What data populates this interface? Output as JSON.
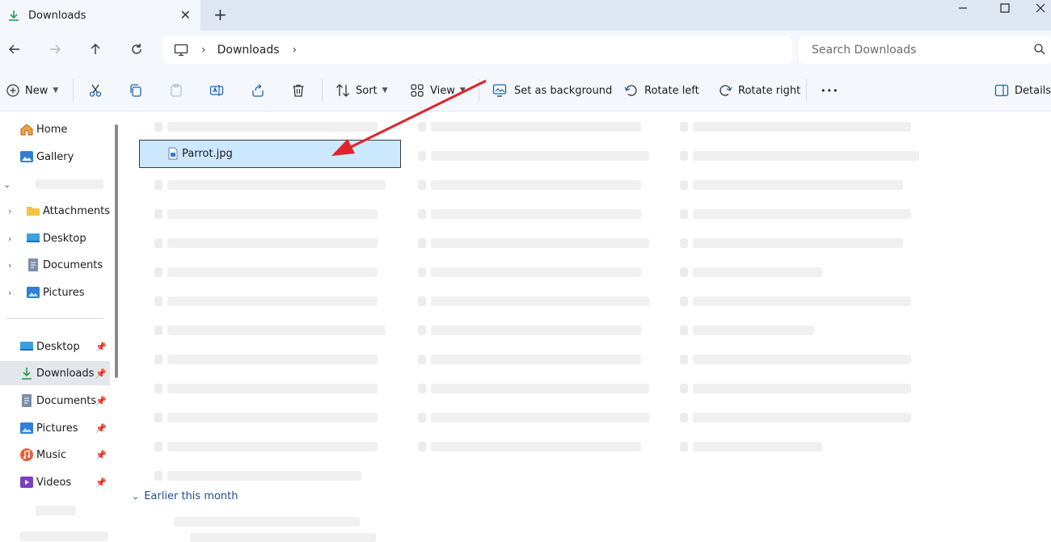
{
  "window": {
    "tab_title": "Downloads",
    "tab_close": "✕",
    "new_tab": "+"
  },
  "address": {
    "breadcrumb": [
      "Downloads"
    ],
    "search_placeholder": "Search Downloads"
  },
  "toolbar": {
    "new_label": "New",
    "sort_label": "Sort",
    "view_label": "View",
    "set_background_label": "Set as background",
    "rotate_left_label": "Rotate left",
    "rotate_right_label": "Rotate right",
    "more_label": "•••",
    "details_label": "Details"
  },
  "sidebar": {
    "top_items": [
      {
        "label": "Home",
        "icon": "home-icon"
      },
      {
        "label": "Gallery",
        "icon": "gallery-icon"
      }
    ],
    "tree_items": [
      {
        "label": "Attachments",
        "icon": "folder-icon"
      },
      {
        "label": "Desktop",
        "icon": "desktop-icon"
      },
      {
        "label": "Documents",
        "icon": "documents-icon"
      },
      {
        "label": "Pictures",
        "icon": "pictures-icon"
      }
    ],
    "quick_access": [
      {
        "label": "Desktop",
        "icon": "desktop-icon",
        "pinned": true
      },
      {
        "label": "Downloads",
        "icon": "download-icon",
        "pinned": true,
        "active": true
      },
      {
        "label": "Documents",
        "icon": "documents-icon",
        "pinned": true
      },
      {
        "label": "Pictures",
        "icon": "pictures-icon",
        "pinned": true
      },
      {
        "label": "Music",
        "icon": "music-icon",
        "pinned": true
      },
      {
        "label": "Videos",
        "icon": "videos-icon",
        "pinned": true
      }
    ]
  },
  "content": {
    "selected_file": "Parrot.jpg",
    "group_header": "Earlier this month"
  },
  "colors": {
    "accent": "#0067c0",
    "selection": "#cce8ff",
    "arrow": "#e0242a"
  }
}
